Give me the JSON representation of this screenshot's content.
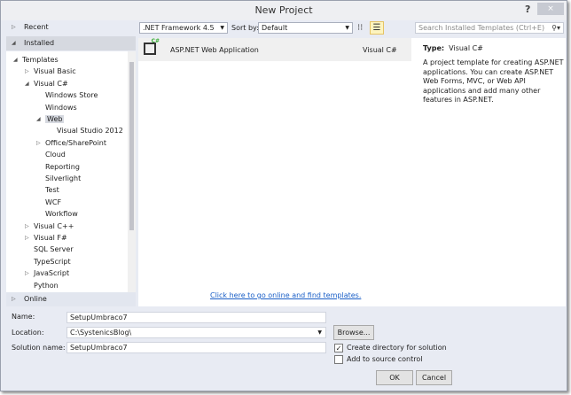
{
  "window": {
    "title": "New Project",
    "help": "?",
    "close": "×"
  },
  "left": {
    "recent": "Recent",
    "installed": "Installed",
    "online": "Online",
    "tree": [
      {
        "label": "Templates",
        "level": 0,
        "toggle": "expanded"
      },
      {
        "label": "Visual Basic",
        "level": 1,
        "toggle": "collapsed"
      },
      {
        "label": "Visual C#",
        "level": 1,
        "toggle": "expanded"
      },
      {
        "label": "Windows Store",
        "level": 2,
        "toggle": ""
      },
      {
        "label": "Windows",
        "level": 2,
        "toggle": ""
      },
      {
        "label": "Web",
        "level": 2,
        "toggle": "expanded",
        "selected": true
      },
      {
        "label": "Visual Studio 2012",
        "level": 3,
        "toggle": ""
      },
      {
        "label": "Office/SharePoint",
        "level": 2,
        "toggle": "collapsed"
      },
      {
        "label": "Cloud",
        "level": 2,
        "toggle": ""
      },
      {
        "label": "Reporting",
        "level": 2,
        "toggle": ""
      },
      {
        "label": "Silverlight",
        "level": 2,
        "toggle": ""
      },
      {
        "label": "Test",
        "level": 2,
        "toggle": ""
      },
      {
        "label": "WCF",
        "level": 2,
        "toggle": ""
      },
      {
        "label": "Workflow",
        "level": 2,
        "toggle": ""
      },
      {
        "label": "Visual C++",
        "level": 1,
        "toggle": "collapsed"
      },
      {
        "label": "Visual F#",
        "level": 1,
        "toggle": "collapsed"
      },
      {
        "label": "SQL Server",
        "level": 1,
        "toggle": ""
      },
      {
        "label": "TypeScript",
        "level": 1,
        "toggle": ""
      },
      {
        "label": "JavaScript",
        "level": 1,
        "toggle": "collapsed"
      },
      {
        "label": "Python",
        "level": 1,
        "toggle": ""
      }
    ]
  },
  "toolbar": {
    "framework": ".NET Framework 4.5",
    "sort_label": "Sort by:",
    "sort_value": "Default",
    "search_placeholder": "Search Installed Templates (Ctrl+E)"
  },
  "templates": [
    {
      "name": "ASP.NET Web Application",
      "language": "Visual C#"
    }
  ],
  "online_link": "Click here to go online and find templates.",
  "details": {
    "type_label": "Type:",
    "type_value": "Visual C#",
    "description": "A project template for creating ASP.NET applications. You can create ASP.NET Web Forms, MVC,  or Web API applications and add many other features in ASP.NET."
  },
  "form": {
    "name_label": "Name:",
    "name_value": "SetupUmbraco7",
    "location_label": "Location:",
    "location_value": "C:\\SystenicsBlog\\",
    "solution_label": "Solution name:",
    "solution_value": "SetupUmbraco7",
    "browse": "Browse...",
    "create_dir": "Create directory for solution",
    "create_dir_checked": true,
    "source_control": "Add to source control",
    "source_control_checked": false,
    "ok": "OK",
    "cancel": "Cancel"
  }
}
